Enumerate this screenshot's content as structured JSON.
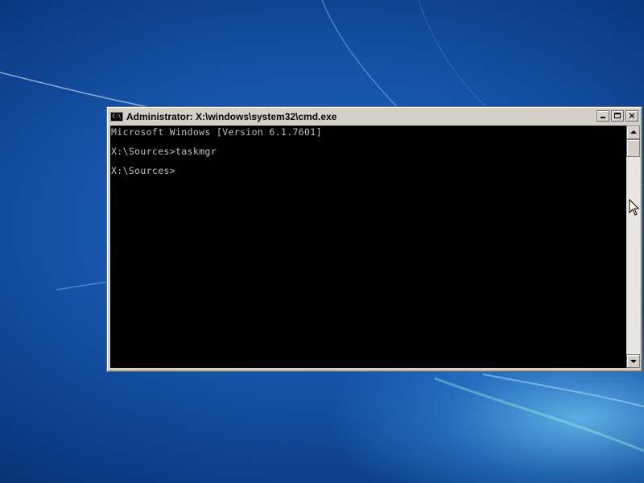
{
  "window": {
    "title": "Administrator: X:\\windows\\system32\\cmd.exe",
    "icon": "cmd-icon",
    "icon_text": "C:\\",
    "buttons": [
      "minimize",
      "maximize",
      "close"
    ],
    "close_glyph": "×"
  },
  "console": {
    "lines": [
      "Microsoft Windows [Version 6.1.7601]",
      "",
      "X:\\Sources>taskmgr",
      "",
      "X:\\Sources>"
    ],
    "background_color": "#000000",
    "text_color": "#c0c0c0"
  },
  "colors": {
    "desktop_primary": "#1553a8",
    "desktop_highlight": "#7fd2ff",
    "window_frame": "#d4d0c8"
  }
}
